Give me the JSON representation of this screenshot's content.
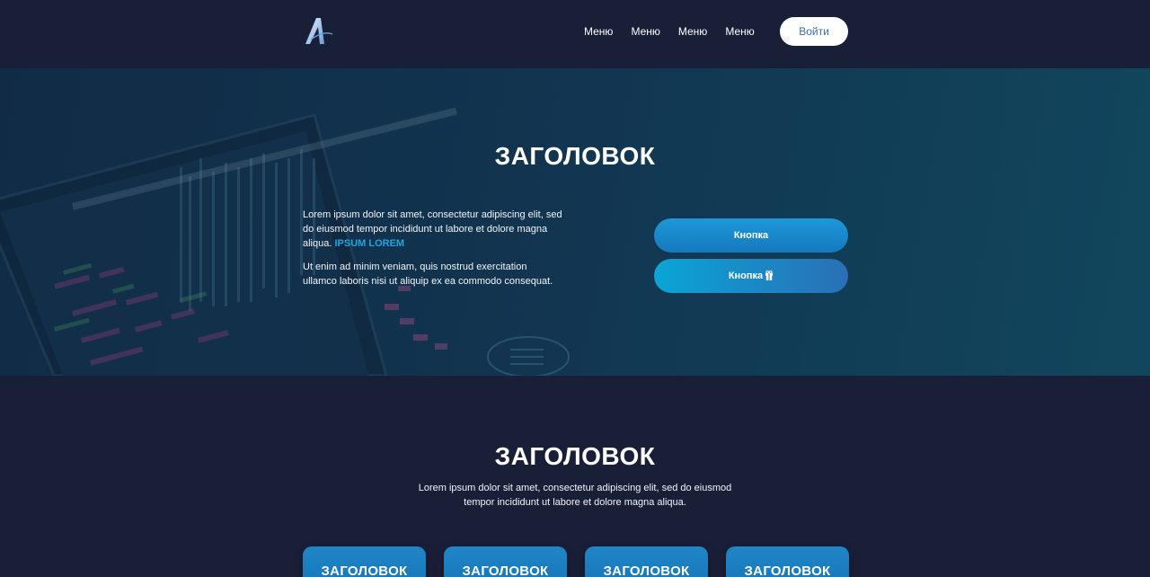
{
  "header": {
    "logo": "logo-a-icon",
    "nav": [
      {
        "label": "Меню"
      },
      {
        "label": "Меню"
      },
      {
        "label": "Меню"
      },
      {
        "label": "Меню"
      }
    ],
    "login_label": "Войти"
  },
  "hero": {
    "title": "ЗАГОЛОВОК",
    "paragraph1": "Lorem ipsum dolor sit amet, consectetur adipiscing elit, sed do eiusmod tempor incididunt ut labore et dolore magna aliqua.",
    "link_label": "IPSUM LOREM",
    "paragraph2": "Ut enim ad minim veniam, quis nostrud exercitation ullamco laboris nisi ut aliquip ex ea commodo consequat.",
    "button1_label": "Кнопка",
    "button2_label": "Кнопка",
    "button2_icon": "gift-icon"
  },
  "section2": {
    "title": "ЗАГОЛОВОК",
    "text": "Lorem ipsum dolor sit amet, consectetur adipiscing elit, sed do eiusmod tempor incididunt ut labore et dolore magna aliqua.",
    "cards": [
      {
        "title": "ЗАГОЛОВОК"
      },
      {
        "title": "ЗАГОЛОВОК"
      },
      {
        "title": "ЗАГОЛОВОК"
      },
      {
        "title": "ЗАГОЛОВОК"
      }
    ]
  },
  "colors": {
    "background": "#1a1f38",
    "accent": "#1e98d8",
    "link": "#1ea7e6",
    "login_text": "#3a6fae"
  }
}
